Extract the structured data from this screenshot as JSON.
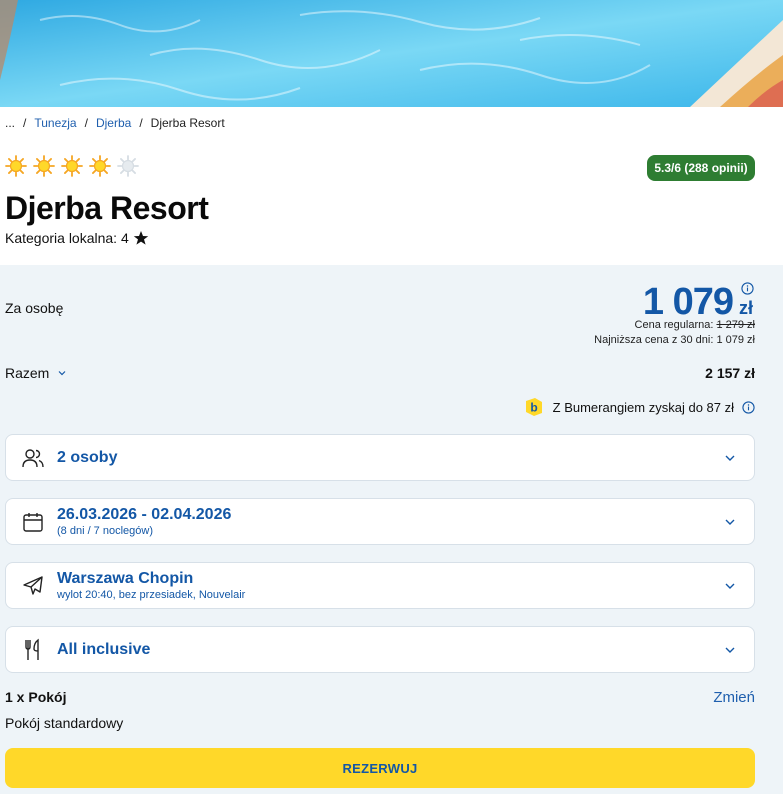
{
  "breadcrumb": {
    "items": [
      "...",
      "Tunezja",
      "Djerba",
      "Djerba Resort"
    ],
    "separator": "/"
  },
  "hotel": {
    "stars_filled": 4,
    "stars_total": 5,
    "name": "Djerba Resort",
    "local_category_label": "Kategoria lokalna: 4",
    "rating_badge": "5.3/6 (288 opinii)"
  },
  "pricing": {
    "per_person_label": "Za osobę",
    "per_person_price": "1 079",
    "currency": "zł",
    "regular_price_label": "Cena regularna:",
    "regular_price_value": "1 279 zł",
    "lowest_30_days": "Najniższa cena z 30 dni: 1 079 zł",
    "total_label": "Razem",
    "total_value": "2 157 zł",
    "bumerang_text": "Z Bumerangiem zyskaj do 87 zł",
    "bumerang_logo_letter": "b"
  },
  "selectors": {
    "persons": {
      "label": "2 osoby",
      "icon": "people-icon"
    },
    "dates": {
      "label": "26.03.2026 - 02.04.2026",
      "sub": "(8 dni / 7 noclegów)",
      "icon": "calendar-icon"
    },
    "flight": {
      "label": "Warszawa Chopin",
      "sub": "wylot 20:40, bez przesiadek, Nouvelair",
      "icon": "plane-icon"
    },
    "board": {
      "label": "All inclusive",
      "icon": "fork-knife-icon"
    }
  },
  "room": {
    "title": "1 x Pokój",
    "change_label": "Zmień",
    "type": "Pokój standardowy"
  },
  "cta": {
    "label": "REZERWUJ"
  },
  "colors": {
    "accent_blue": "#1357a6",
    "rating_green": "#2e7d32",
    "cta_yellow": "#ffd829",
    "sun_orange": "#f5a623",
    "panel_bg": "#eef4f8"
  }
}
